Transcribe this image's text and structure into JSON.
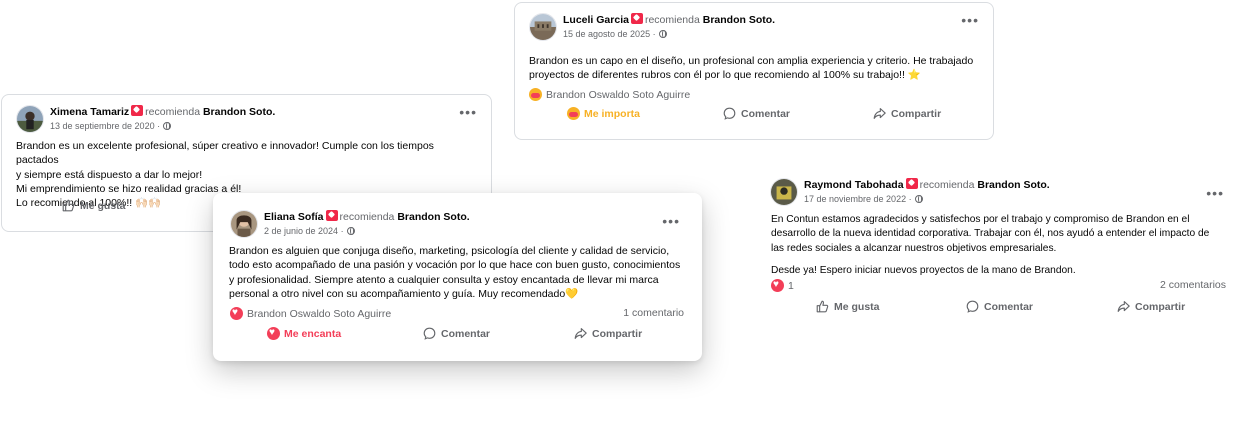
{
  "common": {
    "recommends": "recomienda",
    "target": "Brandon Soto.",
    "more": "•••"
  },
  "posts": [
    {
      "author": "Ximena Tamariz",
      "date": "13 de septiembre de 2020 ·",
      "body": [
        "Brandon es un excelente profesional, súper creativo e innovador! Cumple con los tiempos pactados",
        "y siempre está dispuesto a dar lo mejor!",
        "Mi emprendimiento se hizo realidad gracias a él!",
        "Lo recomiendo al 100%!! 🙌🏻🙌🏻"
      ],
      "actions": {
        "like": "Me gusta"
      }
    },
    {
      "author": "Luceli Garcia",
      "date": "15 de agosto de 2025 ·",
      "body": [
        "Brandon es un capo en el diseño, un profesional con amplia experiencia y criterio. He trabajado",
        "proyectos de diferentes rubros con él por lo que recomiendo al 100% su trabajo!! ⭐"
      ],
      "reactors": "Brandon Oswaldo Soto Aguirre",
      "actions": {
        "react": "Me importa",
        "comment": "Comentar",
        "share": "Compartir"
      }
    },
    {
      "author": "Eliana Sofía",
      "date": "2 de junio de 2024 ·",
      "body": [
        "Brandon es alguien que conjuga diseño, marketing, psicología del cliente y calidad de servicio,",
        "todo esto acompañado de una pasión y vocación por lo que hace con buen gusto, conocimientos",
        "y profesionalidad. Siempre atento a cualquier consulta y estoy encantada de llevar mi marca",
        "personal a otro nivel con su acompañamiento y guía. Muy recomendado💛"
      ],
      "reactors": "Brandon Oswaldo Soto Aguirre",
      "comments": "1 comentario",
      "actions": {
        "react": "Me encanta",
        "comment": "Comentar",
        "share": "Compartir"
      }
    },
    {
      "author": "Raymond Tabohada",
      "date": "17 de noviembre de 2022 ·",
      "body": [
        "En Contun estamos agradecidos y satisfechos por el trabajo y compromiso de Brandon en el",
        "desarrollo de la nueva identidad corporativa. Trabajar con él, nos ayudó a entender el impacto de",
        "las redes sociales a alcanzar nuestros objetivos empresariales.",
        "Desde ya! Espero iniciar nuevos proyectos de la mano de Brandon."
      ],
      "reaction_count": "1",
      "comments": "2 comentarios",
      "actions": {
        "like": "Me gusta",
        "comment": "Comentar",
        "share": "Compartir"
      }
    }
  ],
  "colors": {
    "love": "#f33e58",
    "care": "#f7b125",
    "secondary_text": "#65676b",
    "badge": "#f02849"
  },
  "icons": [
    "more-options-icon",
    "recommend-badge-icon",
    "globe-icon",
    "thumbs-up-icon",
    "comment-icon",
    "share-icon",
    "love-reaction-icon",
    "care-reaction-icon"
  ]
}
